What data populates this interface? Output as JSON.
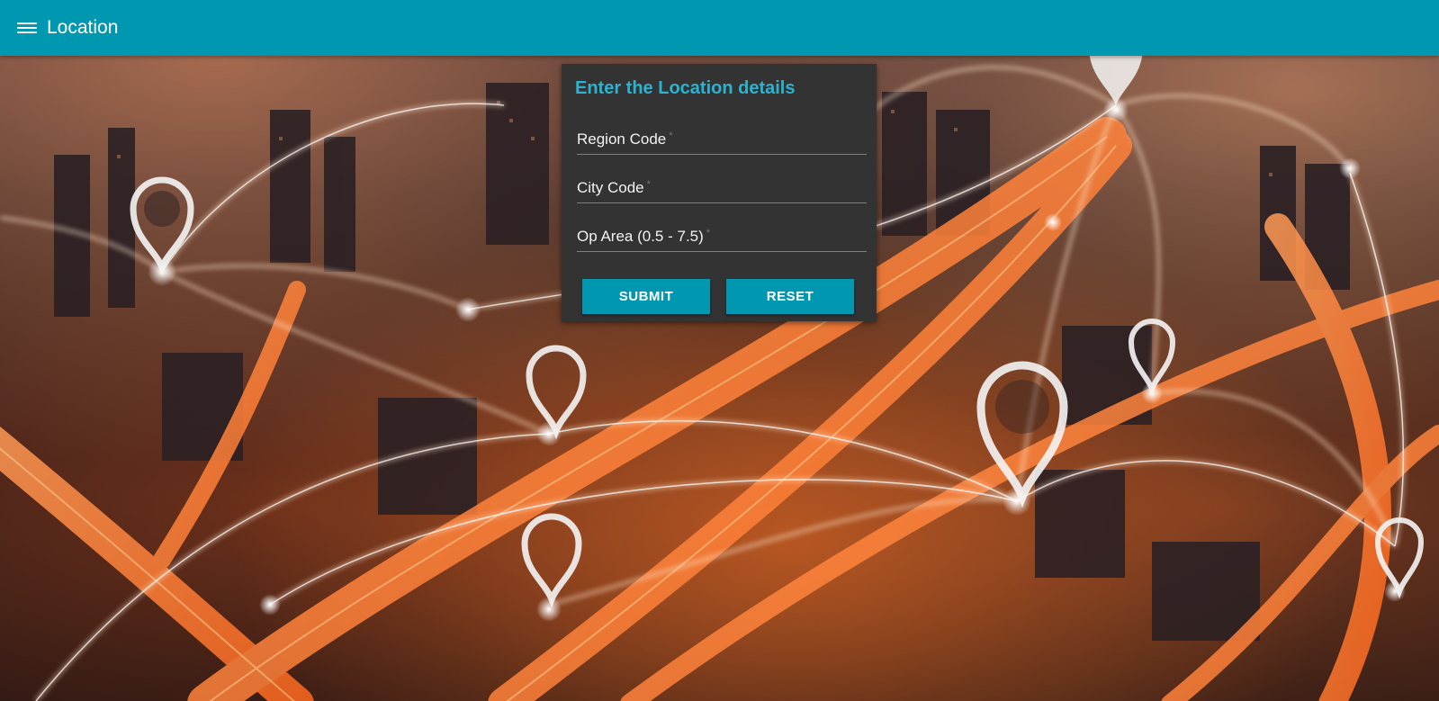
{
  "appbar": {
    "menu_icon": "hamburger-menu-icon",
    "title": "Location"
  },
  "colors": {
    "appbar": "#0097b0",
    "card": "#333333",
    "accent_text": "#2bb3d0",
    "button": "#0097b0"
  },
  "form": {
    "title": "Enter the Location details",
    "fields": [
      {
        "label": "Region Code",
        "required_mark": "*",
        "value": ""
      },
      {
        "label": "City Code",
        "required_mark": "*",
        "value": ""
      },
      {
        "label": "Op Area (0.5 - 7.5)",
        "required_mark": "*",
        "value": ""
      }
    ],
    "submit_label": "SUBMIT",
    "reset_label": "RESET"
  },
  "background": {
    "icon": "location-pin-icon"
  }
}
